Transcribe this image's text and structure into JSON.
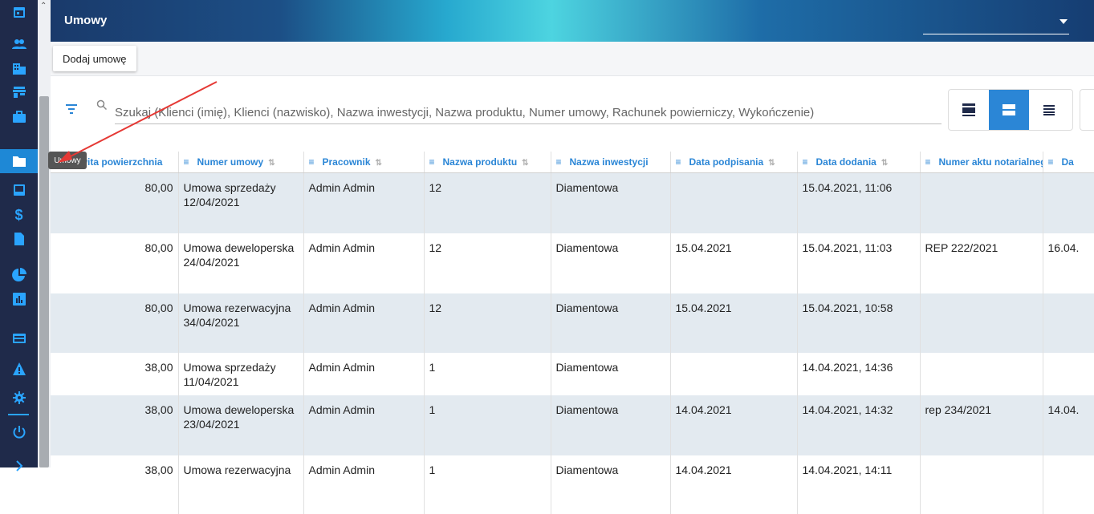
{
  "app": {
    "title": "Umowy"
  },
  "sidebar": {
    "items": [
      {
        "icon": "calendar-icon"
      },
      {
        "icon": "people-icon"
      },
      {
        "icon": "buildings-icon"
      },
      {
        "icon": "store-icon"
      },
      {
        "icon": "briefcase-icon"
      },
      {
        "icon": "folder-icon",
        "active": true
      },
      {
        "icon": "inbox-icon"
      },
      {
        "icon": "dollar-icon",
        "glyph": "$"
      },
      {
        "icon": "file-icon"
      },
      {
        "icon": "pie-chart-icon"
      },
      {
        "icon": "bar-chart-icon"
      },
      {
        "icon": "card-icon"
      },
      {
        "icon": "warning-icon"
      },
      {
        "icon": "gear-icon"
      },
      {
        "icon": "power-icon"
      }
    ],
    "tooltip": "Umowy"
  },
  "toolbar": {
    "add_label": "Dodaj umowę"
  },
  "search": {
    "placeholder": "Szukaj (Klienci (imię), Klienci (nazwisko), Nazwa inwestycji, Nazwa produktu, Numer umowy, Rachunek powierniczy, Wykończenie)"
  },
  "view_modes": [
    "comfortable-view-icon",
    "standard-view-icon",
    "compact-view-icon"
  ],
  "colors": {
    "accent": "#2b86d6",
    "sidebar": "#1f2a4a",
    "row_alt": "#e3eaf0"
  },
  "table": {
    "columns": [
      "całkowita powierzchnia",
      "Numer umowy",
      "Pracownik",
      "Nazwa produktu",
      "Nazwa inwestycji",
      "Data podpisania",
      "Data dodania",
      "Numer aktu notarialnego",
      "Da"
    ],
    "rows": [
      [
        "80,00",
        "Umowa sprzedaży 12/04/2021",
        "Admin Admin",
        "12",
        "Diamentowa",
        "",
        "15.04.2021, 11:06",
        "",
        ""
      ],
      [
        "80,00",
        "Umowa deweloperska 24/04/2021",
        "Admin Admin",
        "12",
        "Diamentowa",
        "15.04.2021",
        "15.04.2021, 11:03",
        "REP 222/2021",
        "16.04."
      ],
      [
        "80,00",
        "Umowa rezerwacyjna 34/04/2021",
        "Admin Admin",
        "12",
        "Diamentowa",
        "15.04.2021",
        "15.04.2021, 10:58",
        "",
        ""
      ],
      [
        "38,00",
        "Umowa sprzedaży 11/04/2021",
        "Admin Admin",
        "1",
        "Diamentowa",
        "",
        "14.04.2021, 14:36",
        "",
        ""
      ],
      [
        "38,00",
        "Umowa deweloperska 23/04/2021",
        "Admin Admin",
        "1",
        "Diamentowa",
        "14.04.2021",
        "14.04.2021, 14:32",
        "rep 234/2021",
        "14.04."
      ],
      [
        "38,00",
        "Umowa rezerwacyjna",
        "Admin Admin",
        "1",
        "Diamentowa",
        "14.04.2021",
        "14.04.2021, 14:11",
        "",
        ""
      ]
    ]
  }
}
